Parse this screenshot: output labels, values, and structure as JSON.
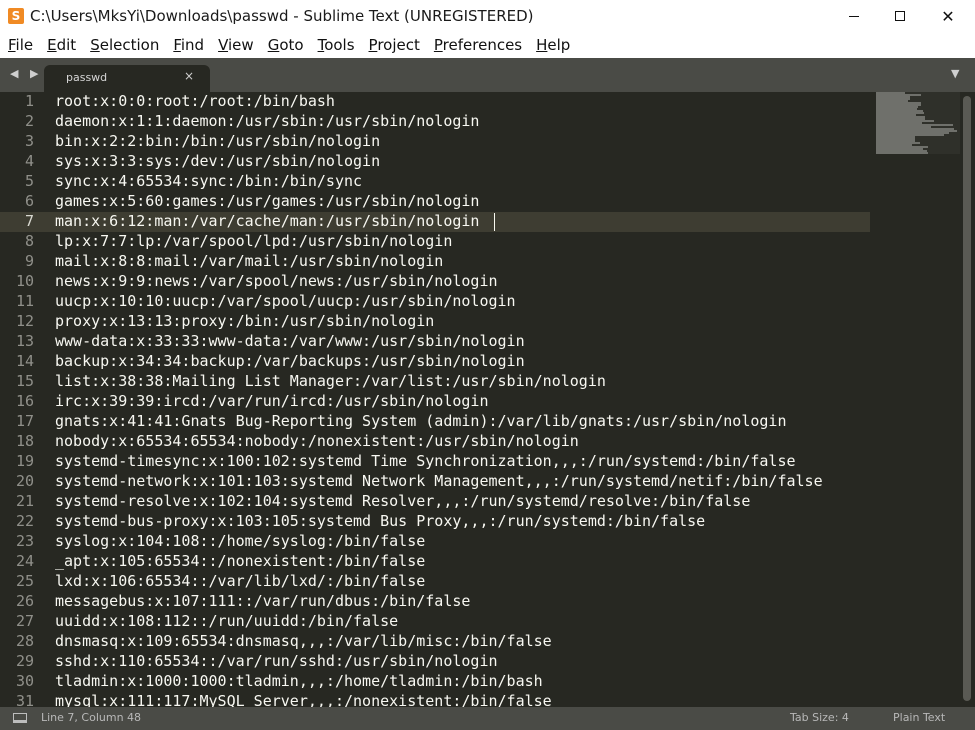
{
  "window": {
    "title": "C:\\Users\\MksYi\\Downloads\\passwd - Sublime Text (UNREGISTERED)",
    "app_icon_letter": "S",
    "close_glyph": "✕"
  },
  "menu": [
    "File",
    "Edit",
    "Selection",
    "Find",
    "View",
    "Goto",
    "Tools",
    "Project",
    "Preferences",
    "Help"
  ],
  "tabs": {
    "nav_arrows": "◀ ▶",
    "active": {
      "label": "passwd",
      "close_glyph": "×"
    },
    "dropdown_glyph": "▼"
  },
  "editor": {
    "current_line": 7,
    "line_numbers": [
      "1",
      "2",
      "3",
      "4",
      "5",
      "6",
      "7",
      "8",
      "9",
      "10",
      "11",
      "12",
      "13",
      "14",
      "15",
      "16",
      "17",
      "18",
      "19",
      "20",
      "21",
      "22",
      "23",
      "24",
      "25",
      "26",
      "27",
      "28",
      "29",
      "30",
      "31"
    ],
    "lines": [
      "root:x:0:0:root:/root:/bin/bash",
      "daemon:x:1:1:daemon:/usr/sbin:/usr/sbin/nologin",
      "bin:x:2:2:bin:/bin:/usr/sbin/nologin",
      "sys:x:3:3:sys:/dev:/usr/sbin/nologin",
      "sync:x:4:65534:sync:/bin:/bin/sync",
      "games:x:5:60:games:/usr/games:/usr/sbin/nologin",
      "man:x:6:12:man:/var/cache/man:/usr/sbin/nologin",
      "lp:x:7:7:lp:/var/spool/lpd:/usr/sbin/nologin",
      "mail:x:8:8:mail:/var/mail:/usr/sbin/nologin",
      "news:x:9:9:news:/var/spool/news:/usr/sbin/nologin",
      "uucp:x:10:10:uucp:/var/spool/uucp:/usr/sbin/nologin",
      "proxy:x:13:13:proxy:/bin:/usr/sbin/nologin",
      "www-data:x:33:33:www-data:/var/www:/usr/sbin/nologin",
      "backup:x:34:34:backup:/var/backups:/usr/sbin/nologin",
      "list:x:38:38:Mailing List Manager:/var/list:/usr/sbin/nologin",
      "irc:x:39:39:ircd:/var/run/ircd:/usr/sbin/nologin",
      "gnats:x:41:41:Gnats Bug-Reporting System (admin):/var/lib/gnats:/usr/sbin/nologin",
      "nobody:x:65534:65534:nobody:/nonexistent:/usr/sbin/nologin",
      "systemd-timesync:x:100:102:systemd Time Synchronization,,,:/run/systemd:/bin/false",
      "systemd-network:x:101:103:systemd Network Management,,,:/run/systemd/netif:/bin/false",
      "systemd-resolve:x:102:104:systemd Resolver,,,:/run/systemd/resolve:/bin/false",
      "systemd-bus-proxy:x:103:105:systemd Bus Proxy,,,:/run/systemd:/bin/false",
      "syslog:x:104:108::/home/syslog:/bin/false",
      "_apt:x:105:65534::/nonexistent:/bin/false",
      "lxd:x:106:65534::/var/lib/lxd/:/bin/false",
      "messagebus:x:107:111::/var/run/dbus:/bin/false",
      "uuidd:x:108:112::/run/uuidd:/bin/false",
      "dnsmasq:x:109:65534:dnsmasq,,,:/var/lib/misc:/bin/false",
      "sshd:x:110:65534::/var/run/sshd:/usr/sbin/nologin",
      "tladmin:x:1000:1000:tladmin,,,:/home/tladmin:/bin/bash",
      "mysql:x:111:117:MySQL Server,,,:/nonexistent:/bin/false"
    ]
  },
  "statusbar": {
    "position": "Line 7, Column 48",
    "tab_size": "Tab Size: 4",
    "syntax": "Plain Text"
  },
  "colors": {
    "editor_bg": "#272822",
    "chrome_bg": "#4a4b46",
    "text": "#f8f8f2",
    "line_number": "#90908a",
    "app_icon": "#f08a24"
  }
}
